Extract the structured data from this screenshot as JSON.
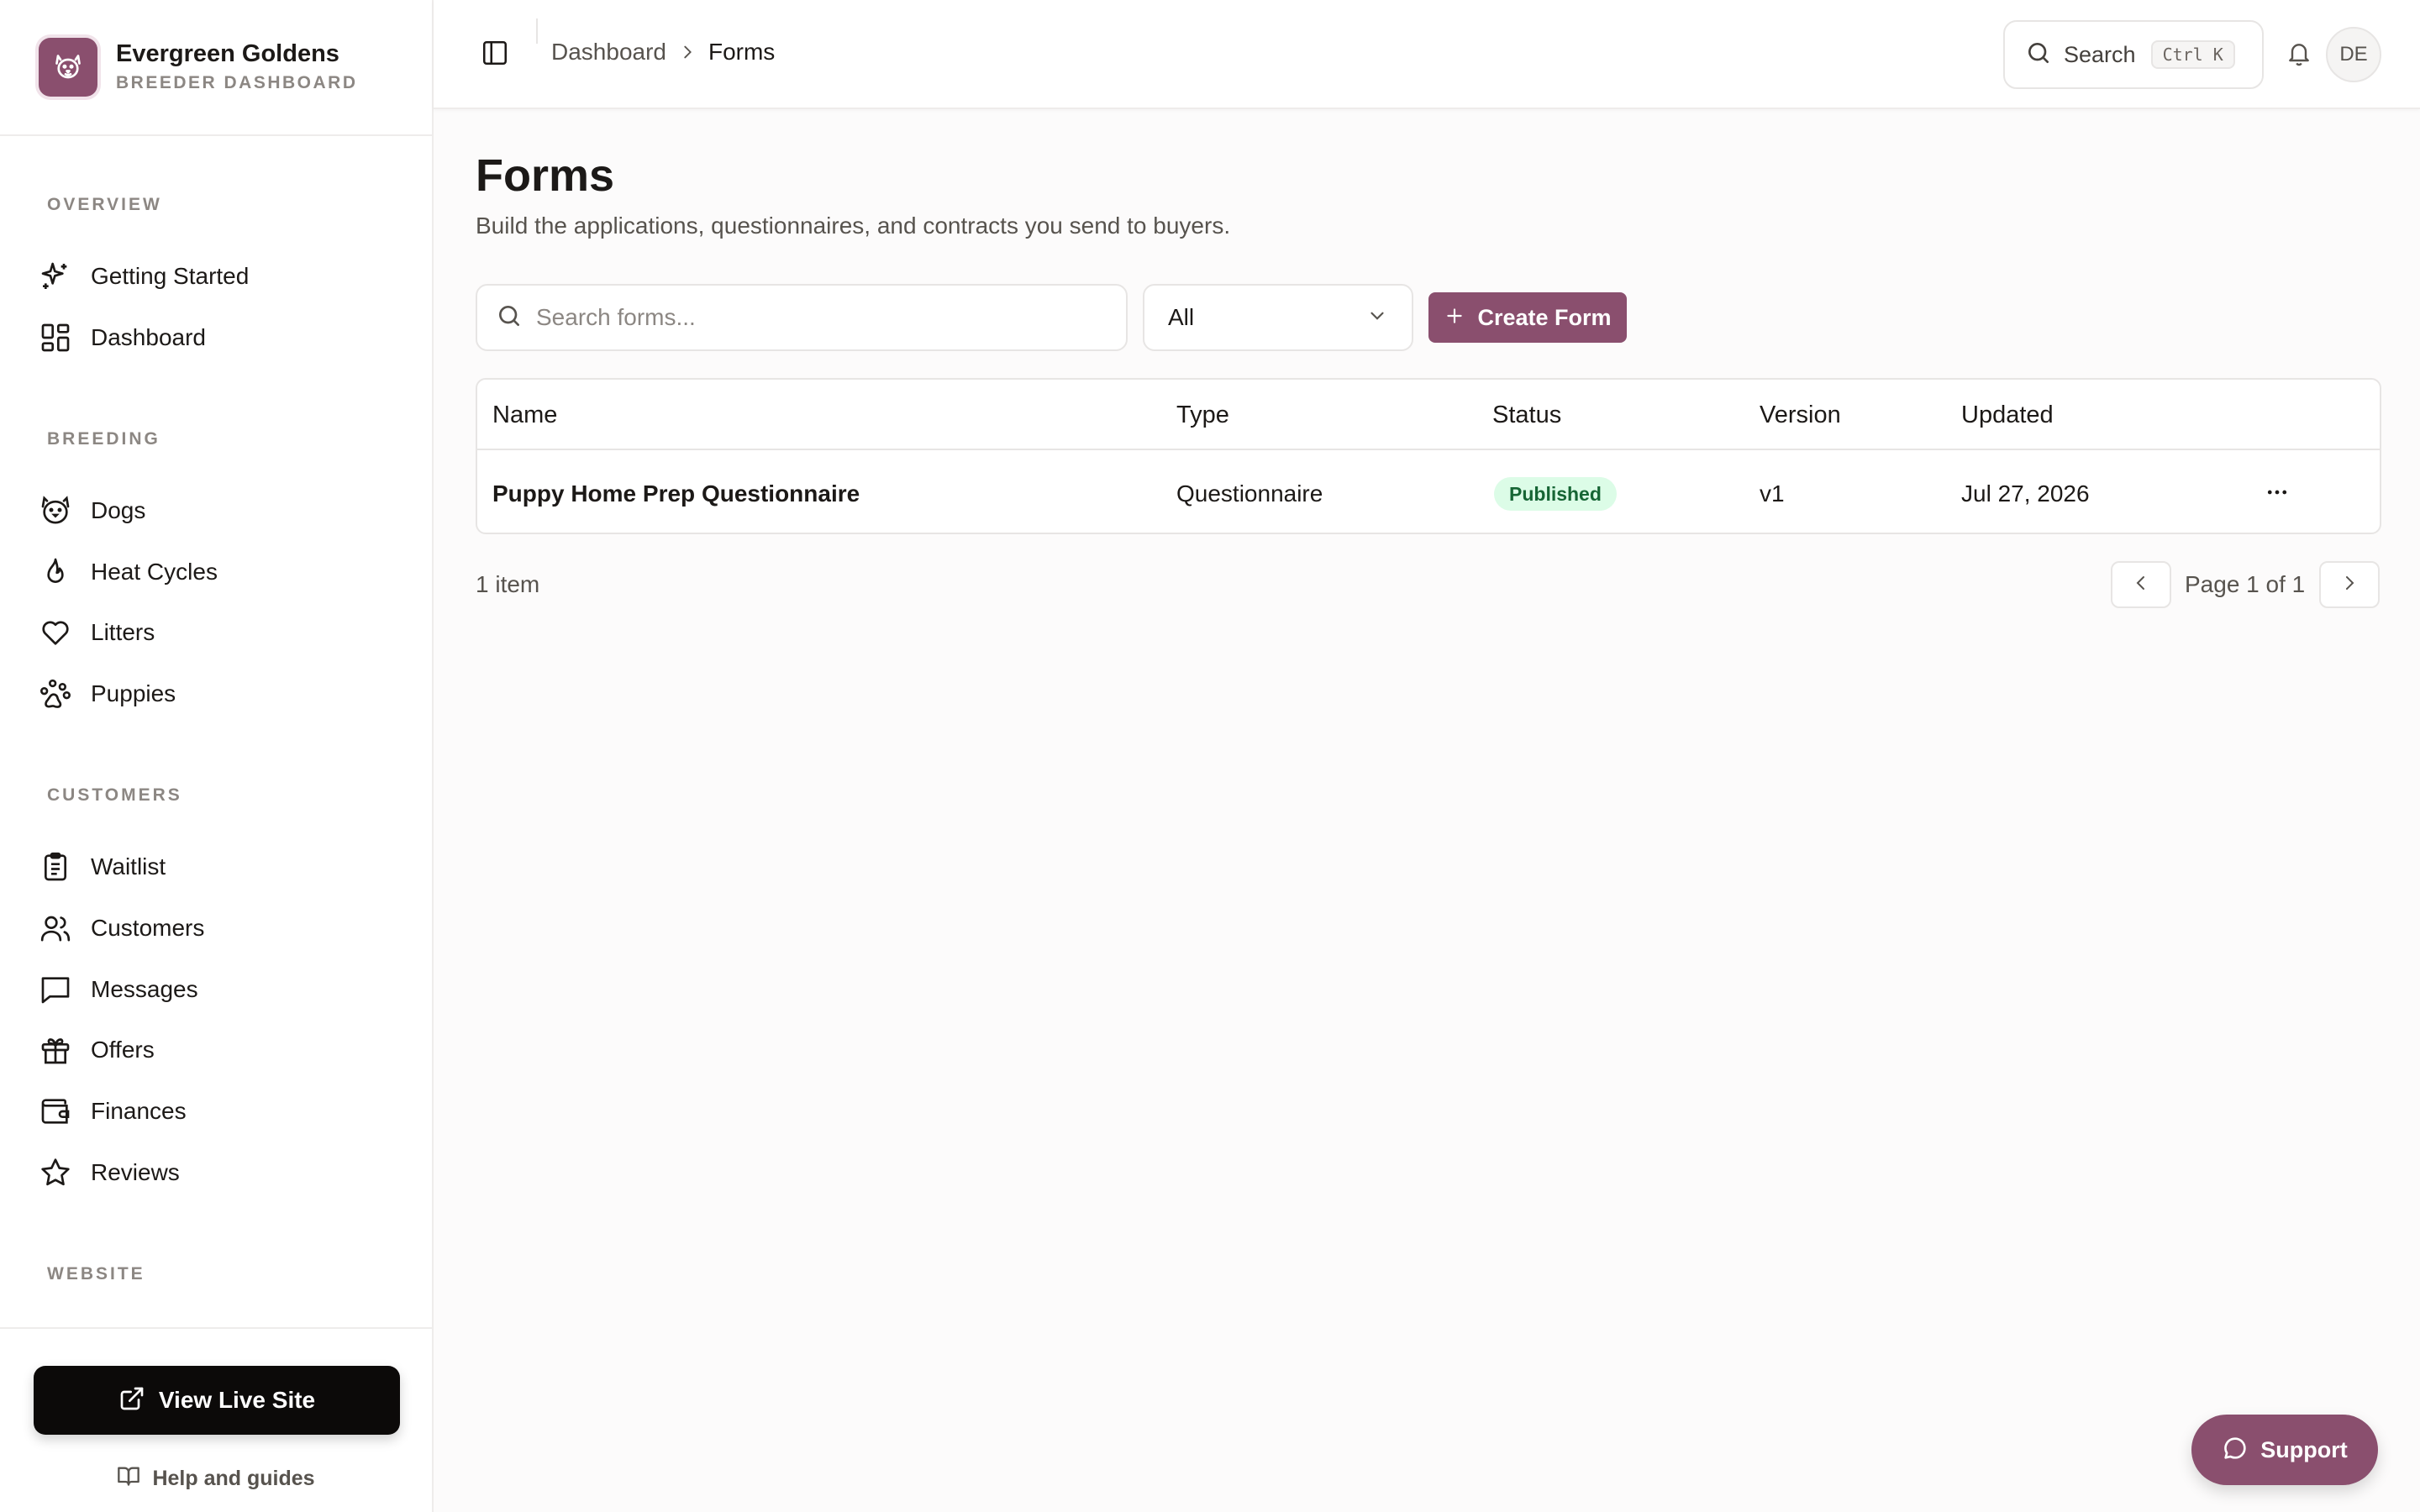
{
  "brand": {
    "name": "Evergreen Goldens",
    "subtitle": "BREEDER DASHBOARD",
    "logo_icon": "dog-face-icon",
    "accent": "#8a4f6e"
  },
  "sidebar": {
    "sections": [
      {
        "label": "OVERVIEW",
        "items": [
          {
            "label": "Getting Started",
            "icon": "sparkles-icon"
          },
          {
            "label": "Dashboard",
            "icon": "layout-grid-icon"
          }
        ]
      },
      {
        "label": "BREEDING",
        "items": [
          {
            "label": "Dogs",
            "icon": "dog-icon"
          },
          {
            "label": "Heat Cycles",
            "icon": "flame-icon"
          },
          {
            "label": "Litters",
            "icon": "heart-icon"
          },
          {
            "label": "Puppies",
            "icon": "paw-icon"
          }
        ]
      },
      {
        "label": "CUSTOMERS",
        "items": [
          {
            "label": "Waitlist",
            "icon": "clipboard-list-icon"
          },
          {
            "label": "Customers",
            "icon": "users-icon"
          },
          {
            "label": "Messages",
            "icon": "message-square-icon"
          },
          {
            "label": "Offers",
            "icon": "gift-icon"
          },
          {
            "label": "Finances",
            "icon": "wallet-icon"
          },
          {
            "label": "Reviews",
            "icon": "star-icon"
          }
        ]
      },
      {
        "label": "WEBSITE",
        "items": []
      }
    ],
    "footer": {
      "live_site_label": "View Live Site",
      "help_label": "Help and guides"
    }
  },
  "header": {
    "breadcrumb": [
      "Dashboard",
      "Forms"
    ],
    "search_label": "Search",
    "search_shortcut": "Ctrl K",
    "avatar_initials": "DE"
  },
  "main": {
    "title": "Forms",
    "subtitle": "Build the applications, questionnaires, and contracts you send to buyers.",
    "search_placeholder": "Search forms...",
    "filter_value": "All",
    "create_label": "Create Form",
    "table": {
      "columns": [
        "Name",
        "Type",
        "Status",
        "Version",
        "Updated"
      ],
      "rows": [
        {
          "name": "Puppy Home Prep Questionnaire",
          "type": "Questionnaire",
          "status": "Published",
          "version": "v1",
          "updated": "Jul 27, 2026"
        }
      ]
    },
    "item_count": "1 item",
    "pagination": "Page 1 of 1"
  },
  "support_label": "Support",
  "colors": {
    "accent": "#8a4f6e",
    "published_bg": "#dcfce7",
    "published_text": "#166534"
  }
}
